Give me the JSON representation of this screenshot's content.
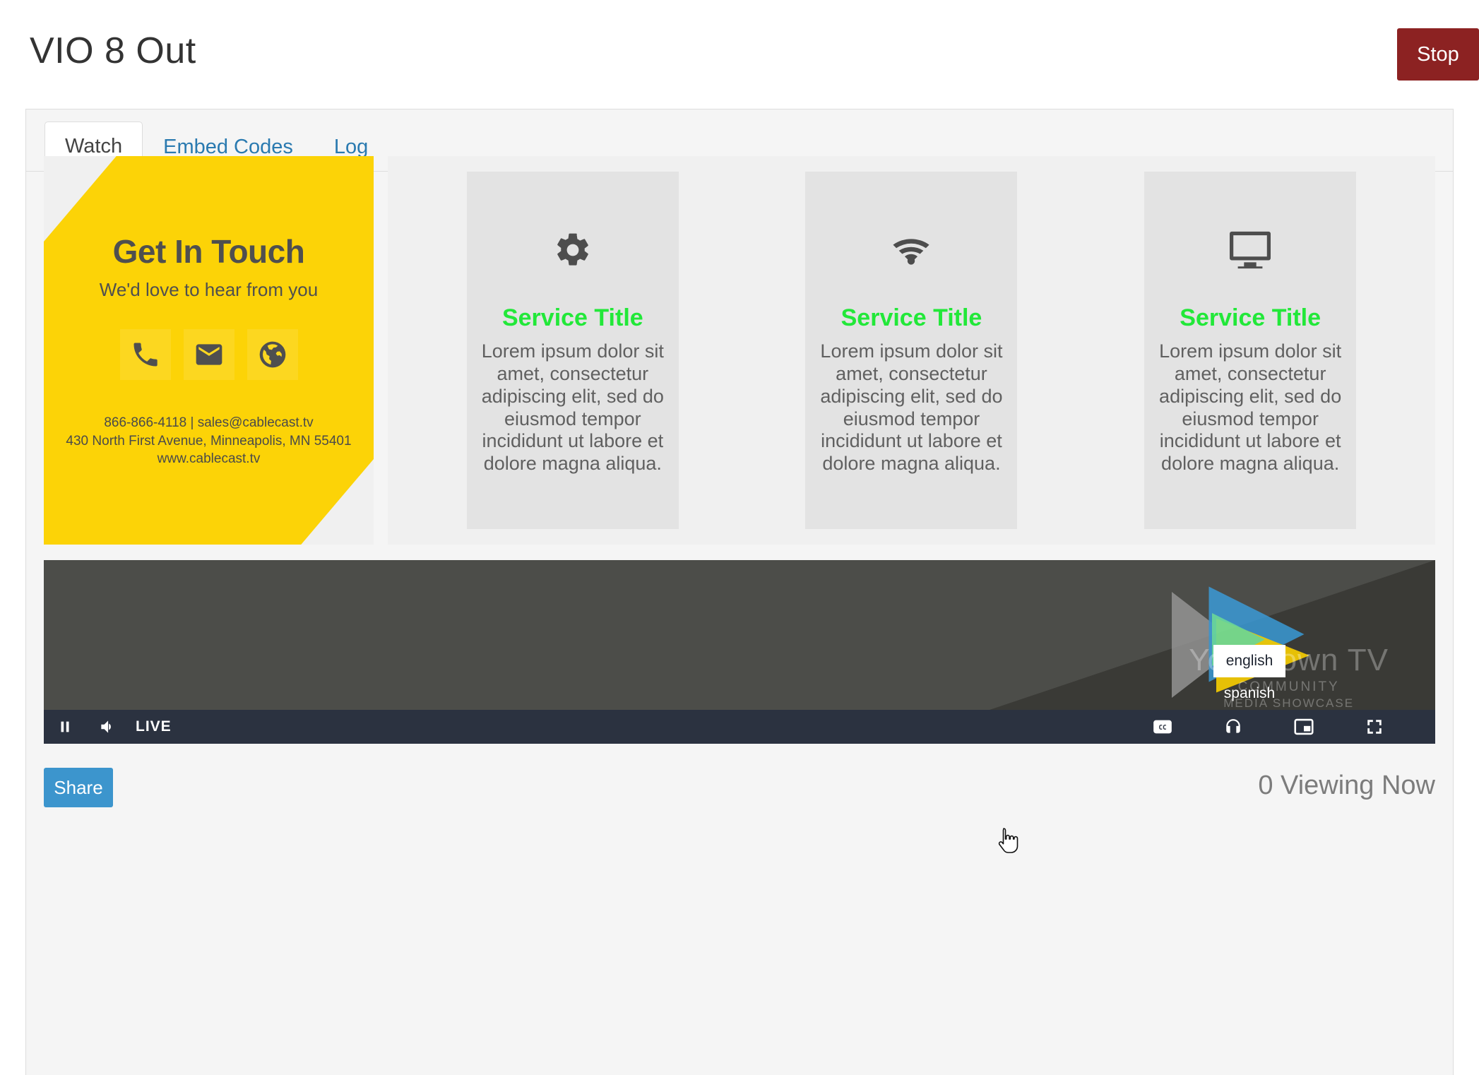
{
  "header": {
    "title": "VIO 8 Out",
    "stop_label": "Stop"
  },
  "tabs": [
    {
      "label": "Watch",
      "active": true
    },
    {
      "label": "Embed Codes",
      "active": false
    },
    {
      "label": "Log",
      "active": false
    }
  ],
  "slide_preview": {
    "contact_card": {
      "title": "Get In Touch",
      "subtitle": "We'd love to hear from you",
      "icons": [
        "phone-icon",
        "envelope-icon",
        "globe-icon"
      ],
      "line1": "866-866-4118 | sales@cablecast.tv",
      "line2": "430 North First Avenue, Minneapolis, MN 55401",
      "line3": "www.cablecast.tv",
      "background_color": "#fcd307",
      "text_color": "#4a4a4a"
    },
    "service_cards": [
      {
        "icon": "gear-icon",
        "title": "Service Title",
        "body": "Lorem ipsum dolor sit amet, consectetur adipiscing elit, sed do eiusmod tempor incididunt ut labore et dolore magna aliqua."
      },
      {
        "icon": "wifi-icon",
        "title": "Service Title",
        "body": "Lorem ipsum dolor sit amet, consectetur adipiscing elit, sed do eiusmod tempor incididunt ut labore et dolore magna aliqua."
      },
      {
        "icon": "monitor-icon",
        "title": "Service Title",
        "body": "Lorem ipsum dolor sit amet, consectetur adipiscing elit, sed do eiusmod tempor incididunt ut labore et dolore magna aliqua."
      }
    ],
    "service_title_color": "#22e839"
  },
  "player": {
    "watermark": {
      "main": "Your Town TV",
      "sub1": "COMMUNITY",
      "sub2": "MEDIA SHOWCASE"
    },
    "controls": {
      "pause": "pause-icon",
      "volume": "volume-icon",
      "live_label": "LIVE",
      "captions": "cc-icon",
      "audio_track": "headphone-icon",
      "picture_in_picture": "pip-icon",
      "fullscreen": "fullscreen-icon"
    },
    "language_menu": {
      "options": [
        {
          "label": "english",
          "selected": true
        },
        {
          "label": "spanish",
          "selected": false
        }
      ]
    }
  },
  "footer": {
    "share_label": "Share",
    "viewing_now": "0 Viewing Now"
  },
  "colors": {
    "stop_button": "#8c2222",
    "share_button": "#3c95cd",
    "tab_link": "#2a7ab0",
    "video_background": "#4c4d49",
    "controls_bar": "#2b3240"
  }
}
